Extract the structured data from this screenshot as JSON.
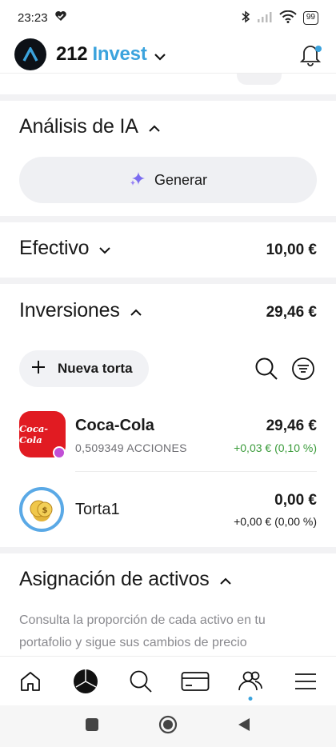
{
  "status": {
    "time": "23:23",
    "battery": "99"
  },
  "header": {
    "brand_number": "212",
    "brand_name": "Invest"
  },
  "ai": {
    "title": "Análisis de IA",
    "generate_label": "Generar"
  },
  "cash": {
    "title": "Efectivo",
    "amount": "10,00 €"
  },
  "investments": {
    "title": "Inversiones",
    "amount": "29,46 €",
    "new_pie_label": "Nueva torta",
    "items": [
      {
        "name": "Coca-Cola",
        "logo_text": "Coca-Cola",
        "shares": "0,509349 ACCIONES",
        "value": "29,46 €",
        "change": "+0,03 € (0,10 %)",
        "change_color": "#3a9b3a",
        "badge_color": "#c14fd6"
      },
      {
        "name": "Torta1",
        "shares": "",
        "value": "0,00 €",
        "change": "+0,00 € (0,00 %)",
        "change_color": "#1a1a1a"
      }
    ]
  },
  "allocation": {
    "title": "Asignación de activos",
    "description": "Consulta la proporción de cada activo en tu portafolio y sigue sus cambios de precio"
  },
  "bottom_nav": {
    "items": [
      "home-icon",
      "portfolio-pie-icon",
      "search-icon",
      "card-icon",
      "community-icon",
      "menu-icon"
    ],
    "active": "portfolio-pie-icon"
  },
  "colors": {
    "accent": "#3ba3dd",
    "positive": "#3a9b3a",
    "coke_red": "#e11b22",
    "section_gap": "#f2f2f4"
  }
}
